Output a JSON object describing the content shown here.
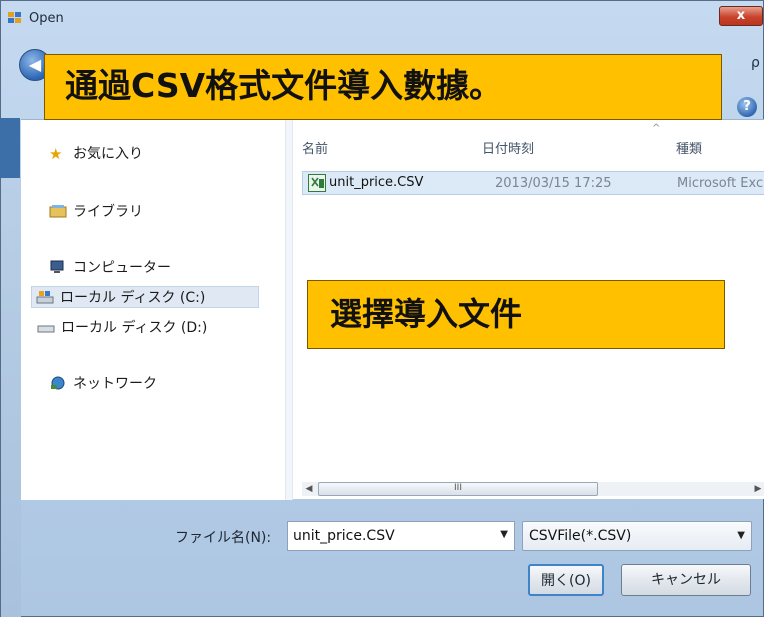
{
  "window": {
    "title": "Open",
    "close_label": "x"
  },
  "nav": {
    "back_icon": "back-arrow-icon",
    "search_glyph": "ρ"
  },
  "help": {
    "label": "?"
  },
  "sidebar": {
    "items": [
      {
        "label": "お気に入り",
        "icon": "star-icon"
      },
      {
        "label": "ライブラリ",
        "icon": "library-icon"
      },
      {
        "label": "コンピューター",
        "icon": "computer-icon"
      },
      {
        "label": "ローカル ディスク (C:)",
        "icon": "drive-c-icon",
        "selected": true
      },
      {
        "label": "ローカル ディスク (D:)",
        "icon": "drive-d-icon"
      },
      {
        "label": "ネットワーク",
        "icon": "network-icon"
      }
    ]
  },
  "file_list": {
    "columns": [
      "名前",
      "日付時刻",
      "種類"
    ],
    "rows": [
      {
        "name": "unit_price.CSV",
        "date": "2013/03/15 17:25",
        "type": "Microsoft Exc"
      }
    ],
    "scroll_thumb_glyph": "III"
  },
  "footer": {
    "filename_label": "ファイル名(N):",
    "filename_value": "unit_price.CSV",
    "filetype_value": "CSVFile(*.CSV)",
    "open_label": "開く(O)",
    "cancel_label": "キャンセル"
  },
  "callouts": {
    "top": "通過CSV格式文件導入數據。",
    "middle": "選擇導入文件"
  },
  "colors": {
    "callout_bg": "#ffc000",
    "selection_bg": "#dce9f7",
    "frame": "#b4cce6"
  }
}
